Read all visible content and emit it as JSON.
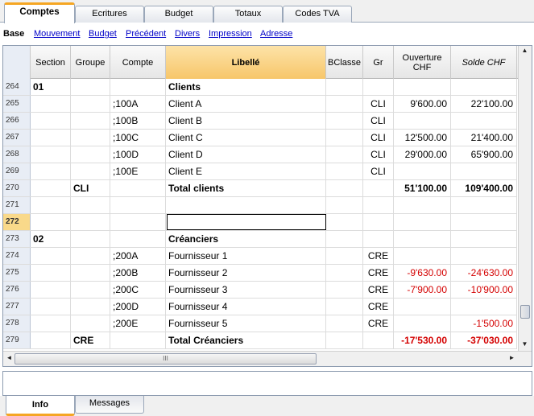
{
  "tabs": [
    "Comptes",
    "Ecritures",
    "Budget",
    "Totaux",
    "Codes TVA"
  ],
  "subnav": {
    "current": "Base",
    "links": [
      "Mouvement",
      "Budget",
      "Précédent",
      "Divers",
      "Impression",
      "Adresse"
    ]
  },
  "columns": [
    "Section",
    "Groupe",
    "Compte",
    "Libellé",
    "BClasse",
    "Gr",
    "Ouverture CHF",
    "Solde CHF"
  ],
  "rows": [
    {
      "num": "264",
      "section": "01",
      "groupe": "",
      "compte": "",
      "libelle": "Clients",
      "bclasse": "",
      "gr": "",
      "ouverture": "",
      "solde": "",
      "bold": true
    },
    {
      "num": "265",
      "section": "",
      "groupe": "",
      "compte": ";100A",
      "libelle": "Client A",
      "bclasse": "",
      "gr": "CLI",
      "ouverture": "9'600.00",
      "solde": "22'100.00"
    },
    {
      "num": "266",
      "section": "",
      "groupe": "",
      "compte": ";100B",
      "libelle": "Client B",
      "bclasse": "",
      "gr": "CLI",
      "ouverture": "",
      "solde": ""
    },
    {
      "num": "267",
      "section": "",
      "groupe": "",
      "compte": ";100C",
      "libelle": "Client C",
      "bclasse": "",
      "gr": "CLI",
      "ouverture": "12'500.00",
      "solde": "21'400.00"
    },
    {
      "num": "268",
      "section": "",
      "groupe": "",
      "compte": ";100D",
      "libelle": "Client D",
      "bclasse": "",
      "gr": "CLI",
      "ouverture": "29'000.00",
      "solde": "65'900.00"
    },
    {
      "num": "269",
      "section": "",
      "groupe": "",
      "compte": ";100E",
      "libelle": "Client E",
      "bclasse": "",
      "gr": "CLI",
      "ouverture": "",
      "solde": ""
    },
    {
      "num": "270",
      "section": "",
      "groupe": "CLI",
      "compte": "",
      "libelle": "Total clients",
      "bclasse": "",
      "gr": "",
      "ouverture": "51'100.00",
      "solde": "109'400.00",
      "bold": true
    },
    {
      "num": "271",
      "section": "",
      "groupe": "",
      "compte": "",
      "libelle": "",
      "bclasse": "",
      "gr": "",
      "ouverture": "",
      "solde": ""
    },
    {
      "num": "272",
      "section": "",
      "groupe": "",
      "compte": "",
      "libelle": "",
      "bclasse": "",
      "gr": "",
      "ouverture": "",
      "solde": "",
      "selected": true
    },
    {
      "num": "273",
      "section": "02",
      "groupe": "",
      "compte": "",
      "libelle": "Créanciers",
      "bclasse": "",
      "gr": "",
      "ouverture": "",
      "solde": "",
      "bold": true
    },
    {
      "num": "274",
      "section": "",
      "groupe": "",
      "compte": ";200A",
      "libelle": "Fournisseur 1",
      "bclasse": "",
      "gr": "CRE",
      "ouverture": "",
      "solde": ""
    },
    {
      "num": "275",
      "section": "",
      "groupe": "",
      "compte": ";200B",
      "libelle": "Fournisseur 2",
      "bclasse": "",
      "gr": "CRE",
      "ouverture": "-9'630.00",
      "solde": "-24'630.00",
      "negative": true
    },
    {
      "num": "276",
      "section": "",
      "groupe": "",
      "compte": ";200C",
      "libelle": "Fournisseur 3",
      "bclasse": "",
      "gr": "CRE",
      "ouverture": "-7'900.00",
      "solde": "-10'900.00",
      "negative": true
    },
    {
      "num": "277",
      "section": "",
      "groupe": "",
      "compte": ";200D",
      "libelle": "Fournisseur 4",
      "bclasse": "",
      "gr": "CRE",
      "ouverture": "",
      "solde": ""
    },
    {
      "num": "278",
      "section": "",
      "groupe": "",
      "compte": ";200E",
      "libelle": "Fournisseur 5",
      "bclasse": "",
      "gr": "CRE",
      "ouverture": "",
      "solde": "-1'500.00",
      "negative": true
    },
    {
      "num": "279",
      "section": "",
      "groupe": "CRE",
      "compte": "",
      "libelle": "Total Créanciers",
      "bclasse": "",
      "gr": "",
      "ouverture": "-17'530.00",
      "solde": "-37'030.00",
      "bold": true,
      "negative": true
    }
  ],
  "scroll_grip": "III",
  "bottom_tabs": [
    "Info",
    "Messages"
  ]
}
